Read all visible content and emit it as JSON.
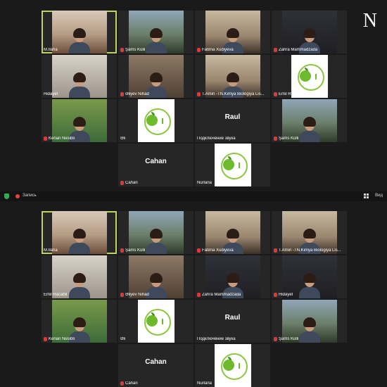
{
  "brand": {
    "letter": "N"
  },
  "toolbar": {
    "recording_label": "Запись",
    "view_label": "Вид",
    "shield_color": "#35a853",
    "record_color": "#e4433b"
  },
  "accent": {
    "active_speaker": "#b9d65a",
    "muted": "#d83b3b"
  },
  "top_grid": [
    {
      "name": "M.İlaha",
      "muted": false,
      "kind": "video",
      "scene": "room-a",
      "active": true
    },
    {
      "name": "Şams Külli",
      "muted": true,
      "kind": "video",
      "scene": "room-b"
    },
    {
      "name": "Fatima Xudiyeva",
      "muted": true,
      "kind": "video",
      "scene": "room-c"
    },
    {
      "name": "Zahra Mammadzada",
      "muted": true,
      "kind": "video",
      "scene": "room-d"
    },
    {
      "name": "Hidayet",
      "muted": false,
      "kind": "video",
      "scene": "room-e"
    },
    {
      "name": "Əliyev Nihad",
      "muted": true,
      "kind": "video",
      "scene": "room-f"
    },
    {
      "name": "T.Amin -TN.Kimya Biologiya Lis...",
      "muted": true,
      "kind": "video",
      "scene": "room-c"
    },
    {
      "name": "Emil Racabli",
      "muted": true,
      "kind": "logo",
      "scene": "logo"
    },
    {
      "name": "Kenan Nesibli",
      "muted": true,
      "kind": "video",
      "scene": "room-g"
    },
    {
      "name": "Əli",
      "muted": false,
      "kind": "logo",
      "scene": "logo"
    },
    {
      "name": "Подключение звука",
      "muted": false,
      "kind": "name",
      "display": "Raul"
    },
    {
      "name": "Şams Külli",
      "muted": true,
      "kind": "video",
      "scene": "room-b"
    },
    {
      "name": "Cahan",
      "muted": true,
      "kind": "name",
      "display": "Cahan"
    },
    {
      "name": "Nurlana",
      "muted": false,
      "kind": "logo",
      "scene": "logo"
    }
  ],
  "bottom_grid": [
    {
      "name": "M.İlaha",
      "muted": false,
      "kind": "video",
      "scene": "room-a",
      "active": true
    },
    {
      "name": "Şams Külli",
      "muted": true,
      "kind": "video",
      "scene": "room-b"
    },
    {
      "name": "Fatima Xudiyeva",
      "muted": true,
      "kind": "video",
      "scene": "room-c"
    },
    {
      "name": "T.Amin -TN.Kimya Biologiya Lis...",
      "muted": true,
      "kind": "video",
      "scene": "room-c"
    },
    {
      "name": "Emil Racabli",
      "muted": false,
      "kind": "video",
      "scene": "room-e"
    },
    {
      "name": "Əliyev Nihad",
      "muted": true,
      "kind": "video",
      "scene": "room-f"
    },
    {
      "name": "Zahra Mammadzada",
      "muted": true,
      "kind": "video",
      "scene": "room-d"
    },
    {
      "name": "Hidayet",
      "muted": true,
      "kind": "video",
      "scene": "room-d"
    },
    {
      "name": "Kenan Nesibli",
      "muted": true,
      "kind": "video",
      "scene": "room-g"
    },
    {
      "name": "Əli",
      "muted": false,
      "kind": "logo",
      "scene": "logo"
    },
    {
      "name": "Подключение звука",
      "muted": false,
      "kind": "name",
      "display": "Raul"
    },
    {
      "name": "Şams Külli",
      "muted": true,
      "kind": "video",
      "scene": "room-b"
    },
    {
      "name": "Cahan",
      "muted": true,
      "kind": "name",
      "display": "Cahan"
    },
    {
      "name": "Nurlana",
      "muted": false,
      "kind": "logo",
      "scene": "logo"
    }
  ]
}
